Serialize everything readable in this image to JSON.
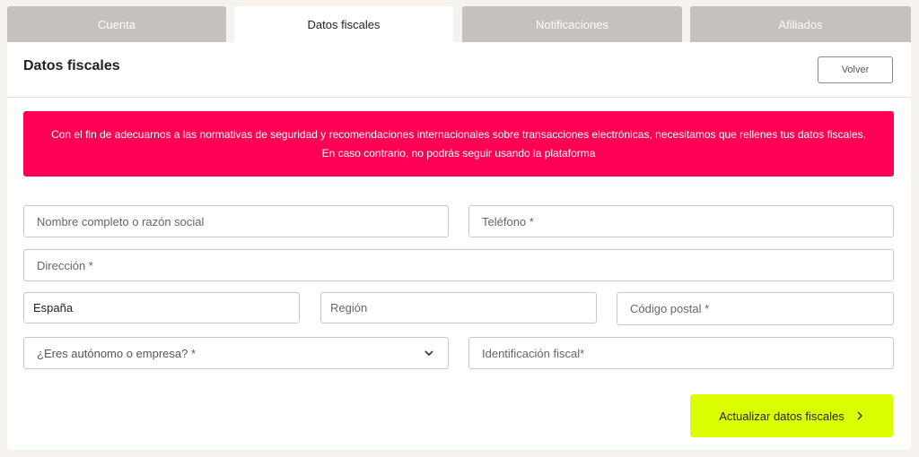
{
  "tabs": [
    {
      "label": "Cuenta",
      "active": false
    },
    {
      "label": "Datos fiscales",
      "active": true
    },
    {
      "label": "Notificaciones",
      "active": false
    },
    {
      "label": "Afiliados",
      "active": false
    }
  ],
  "header": {
    "title": "Datos fiscales",
    "back_label": "Volver"
  },
  "alert": {
    "line1": "Con el fin de adecuarnos a las normativas de seguridad y recomendaciones internacionales sobre transacciones electrónicas, necesitamos que rellenes tus datos fiscales.",
    "line2": "En caso contrario, no podrás seguir usando la plataforma",
    "color": "#ff0055"
  },
  "form": {
    "name_placeholder": "Nombre completo o razón social",
    "phone_placeholder": "Teléfono *",
    "address_placeholder": "Dirección *",
    "country_value": "España",
    "region_placeholder": "Región",
    "postal_placeholder": "Código postal *",
    "type_placeholder": "¿Eres autónomo o empresa? *",
    "taxid_placeholder": "Identificación fiscal*"
  },
  "submit": {
    "label": "Actualizar datos fiscales",
    "color": "#dcff00",
    "icon": "chevron-right-icon"
  }
}
